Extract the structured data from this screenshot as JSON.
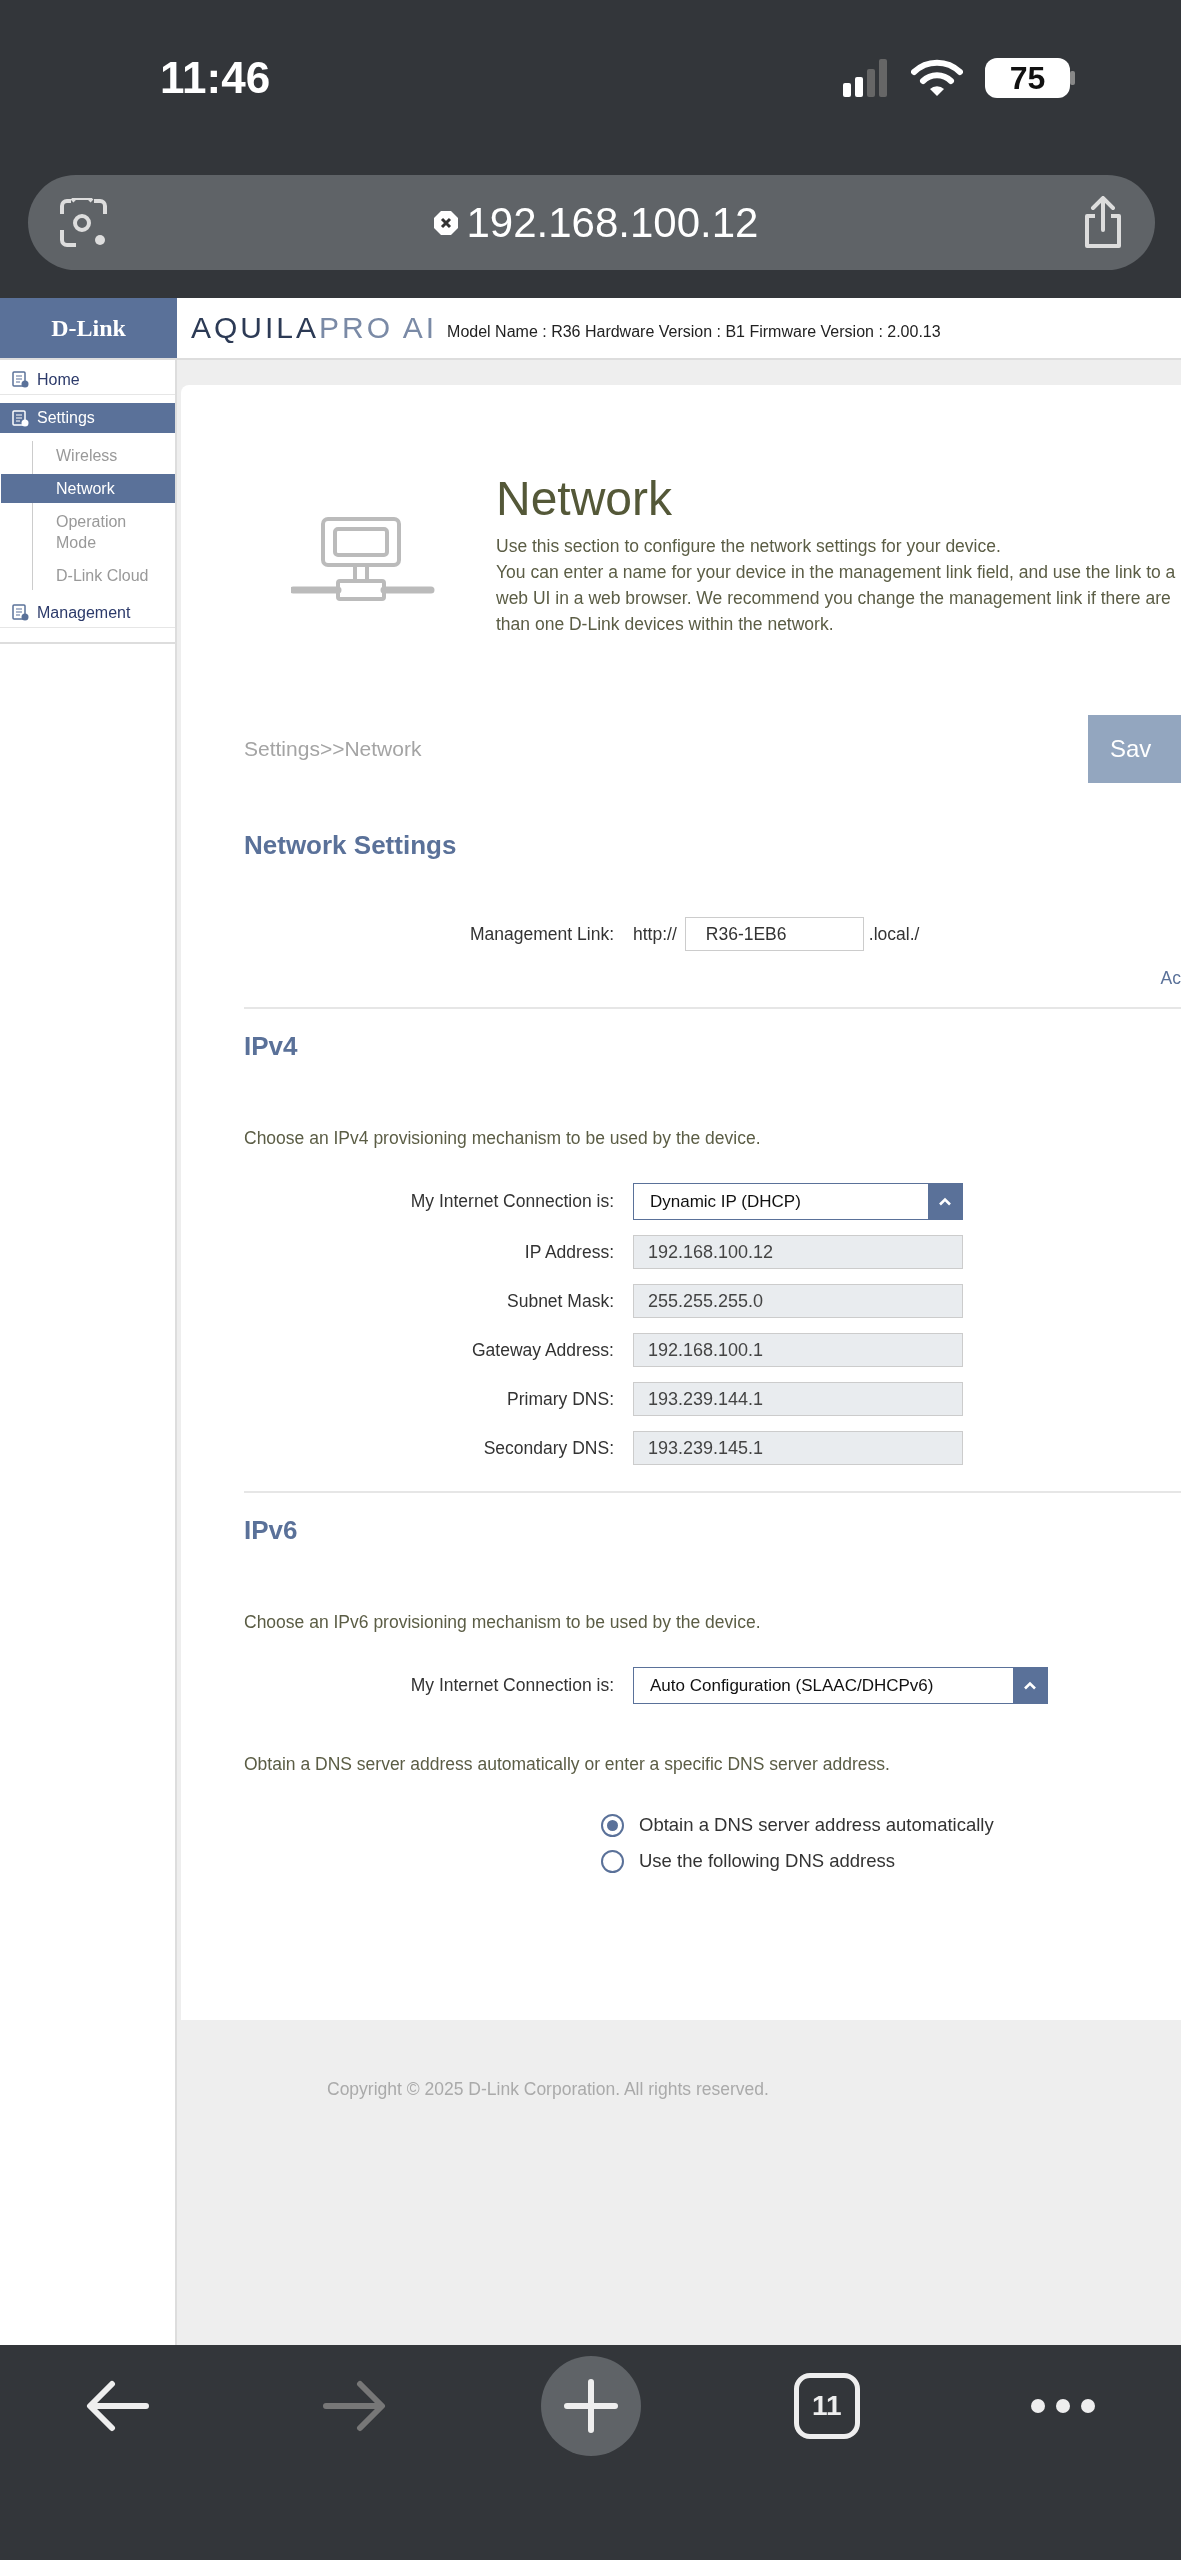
{
  "status_bar": {
    "time": "11:46",
    "battery": "75"
  },
  "browser": {
    "url": "192.168.100.12",
    "tab_count": "11"
  },
  "header": {
    "logo": "D-Link",
    "product_brand": "AQUILA",
    "product_line": "PRO AI",
    "model_info": "Model Name : R36 Hardware Version : B1 Firmware Version : 2.00.13"
  },
  "sidebar": {
    "items": [
      {
        "label": "Home",
        "selected": false
      },
      {
        "label": "Settings",
        "selected": true,
        "children": [
          {
            "label": "Wireless",
            "selected": false
          },
          {
            "label": "Network",
            "selected": true
          },
          {
            "label": "Operation Mode",
            "selected": false
          },
          {
            "label": "D-Link Cloud",
            "selected": false
          }
        ]
      },
      {
        "label": "Management",
        "selected": false
      }
    ]
  },
  "page": {
    "title": "Network",
    "description": "Use this section to configure the network settings for your device.\nYou can enter a name for your device in the management link field, and use the link to a\nweb UI in a web browser. We recommend you change the management link if there are\nthan one D-Link devices within the network.",
    "breadcrumb": "Settings>>Network",
    "save_button": "Sav"
  },
  "network_settings": {
    "heading": "Network Settings",
    "management_link": {
      "label": "Management Link:",
      "prefix": "http://",
      "value": "R36-1EB6",
      "suffix": ".local./"
    },
    "link": "Ac"
  },
  "ipv4": {
    "heading": "IPv4",
    "description": "Choose an IPv4 provisioning mechanism to be used by the device.",
    "fields": [
      {
        "kind": "select",
        "label": "My Internet Connection is:",
        "value": "Dynamic IP (DHCP)"
      },
      {
        "kind": "readonly",
        "label": "IP Address:",
        "value": "192.168.100.12"
      },
      {
        "kind": "readonly",
        "label": "Subnet Mask:",
        "value": "255.255.255.0"
      },
      {
        "kind": "readonly",
        "label": "Gateway Address:",
        "value": "192.168.100.1"
      },
      {
        "kind": "readonly",
        "label": "Primary DNS:",
        "value": "193.239.144.1"
      },
      {
        "kind": "readonly",
        "label": "Secondary DNS:",
        "value": "193.239.145.1"
      }
    ]
  },
  "ipv6": {
    "heading": "IPv6",
    "description": "Choose an IPv6 provisioning mechanism to be used by the device.",
    "fields": [
      {
        "kind": "select",
        "label": "My Internet Connection is:",
        "value": "Auto Configuration (SLAAC/DHCPv6)"
      }
    ],
    "dns_description": "Obtain a DNS server address automatically or enter a specific DNS server address.",
    "dns_options": [
      {
        "label": "Obtain a DNS server address automatically",
        "selected": true
      },
      {
        "label": "Use the following DNS address",
        "selected": false
      }
    ]
  },
  "footer": {
    "copyright": "Copyright © 2025 D-Link Corporation. All rights reserved."
  }
}
